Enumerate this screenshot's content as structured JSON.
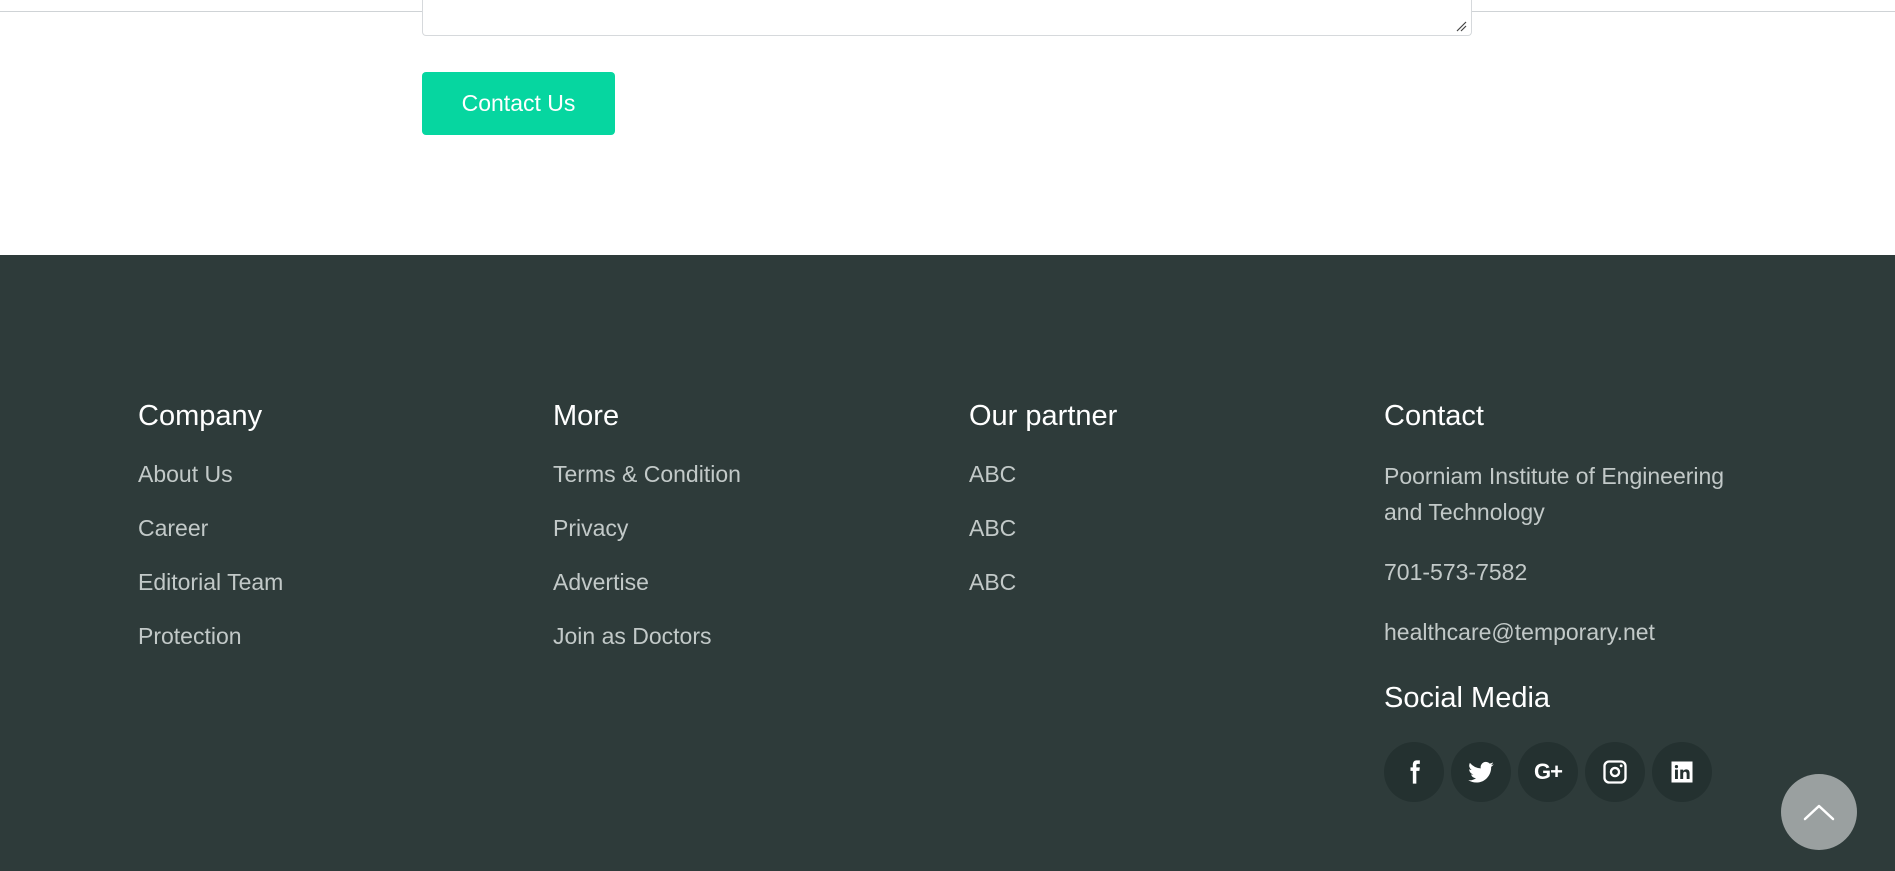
{
  "form": {
    "submit_label": "Contact Us"
  },
  "footer": {
    "company": {
      "title": "Company",
      "links": [
        "About Us",
        "Career",
        "Editorial Team",
        "Protection"
      ]
    },
    "more": {
      "title": "More",
      "links": [
        "Terms & Condition",
        "Privacy",
        "Advertise",
        "Join as Doctors"
      ]
    },
    "partner": {
      "title": "Our partner",
      "links": [
        "ABC",
        "ABC",
        "ABC"
      ]
    },
    "contact": {
      "title": "Contact",
      "address": "Poorniam Institute of Engineering and Technology",
      "phone": "701-573-7582",
      "email": "healthcare@temporary.net"
    },
    "social": {
      "title": "Social Media",
      "icons": [
        "facebook-icon",
        "twitter-icon",
        "google-plus-icon",
        "instagram-icon",
        "linkedin-icon"
      ]
    }
  },
  "colors": {
    "accent": "#06d6a0",
    "footer_bg": "#2e3b3a",
    "social_bg": "#243130",
    "scroll_top_bg": "#9aa0a0"
  }
}
